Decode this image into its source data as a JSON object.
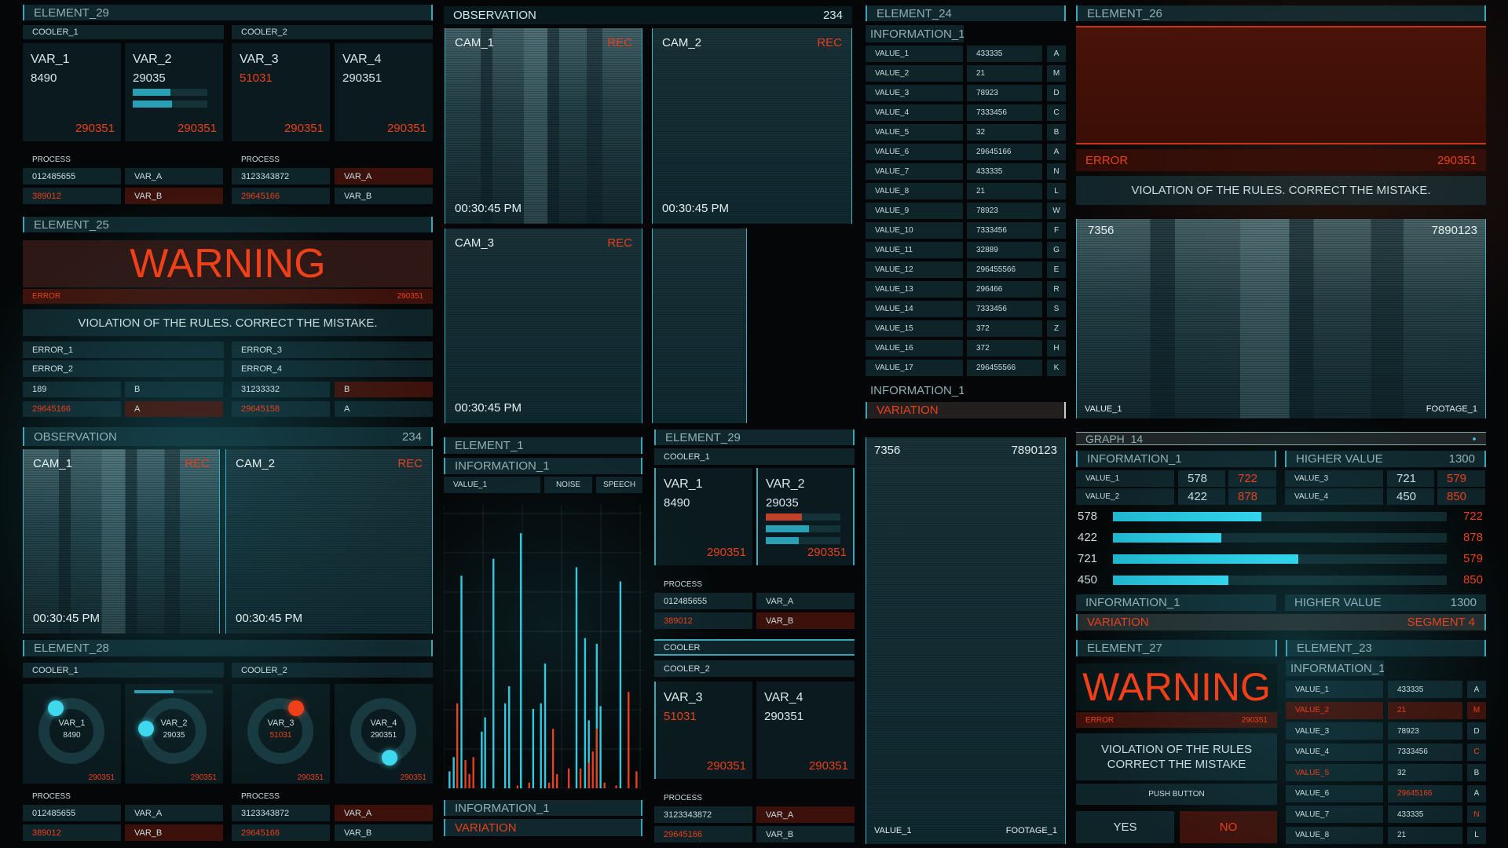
{
  "colors": {
    "accent": "#2fc9e0",
    "alert": "#e8401c",
    "text": "#c9dde0",
    "panel": "#1c4a54"
  },
  "top_left": {
    "title": "ELEMENT_29",
    "cooler_1": "COOLER_1",
    "cooler_2": "COOLER_2",
    "vars": [
      {
        "label": "VAR_1",
        "value": "8490",
        "footer": "290351"
      },
      {
        "label": "VAR_2",
        "value": "29035",
        "footer": "290351",
        "bars": [
          {
            "fill": 0.5,
            "color": "cyan"
          },
          {
            "fill": 0.53,
            "color": "cyan"
          }
        ]
      },
      {
        "label": "VAR_3",
        "value": "51031",
        "value_alert": true,
        "footer": "290351"
      },
      {
        "label": "VAR_4",
        "value": "290351",
        "footer": "290351"
      }
    ],
    "process": [
      {
        "label": "PROCESS",
        "rows": [
          {
            "a": "012485655",
            "b": "VAR_A"
          },
          {
            "a": "389012",
            "a_alert": true,
            "b": "VAR_B",
            "b_alert_bg": true
          }
        ]
      },
      {
        "label": "PROCESS",
        "rows": [
          {
            "a": "3123343872",
            "b": "VAR_A",
            "b_alert_bg": true
          },
          {
            "a": "29645166",
            "a_alert": true,
            "b": "VAR_B"
          }
        ]
      }
    ]
  },
  "element_25": {
    "title": "ELEMENT_25",
    "warning": "WARNING",
    "error_label": "ERROR",
    "error_code": "290351",
    "message": "VIOLATION OF THE RULES. CORRECT THE MISTAKE.",
    "errors": [
      "ERROR_1",
      "ERROR_3",
      "ERROR_2",
      "ERROR_4"
    ],
    "rows": [
      {
        "a": "189",
        "b": "B"
      },
      {
        "a": "31233332",
        "b": "B",
        "b_alert_bg": true
      },
      {
        "a": "29645166",
        "a_alert": true,
        "b": "A",
        "b_alert_bg": true
      },
      {
        "a": "29645158",
        "a_alert": true,
        "b": "A"
      }
    ]
  },
  "observation_left": {
    "title": "OBSERVATION",
    "count": "234",
    "cams": [
      {
        "name": "CAM_1",
        "rec": "REC",
        "time": "00:30:45 PM"
      },
      {
        "name": "CAM_2",
        "rec": "REC",
        "time": "00:30:45 PM"
      }
    ]
  },
  "element_28": {
    "title": "ELEMENT_28",
    "cooler_1": "COOLER_1",
    "cooler_2": "COOLER_2",
    "dials": [
      {
        "label": "VAR_1",
        "value": "8490",
        "footer": "290351",
        "angle_deg": -34,
        "dot": "cyan"
      },
      {
        "label": "VAR_2",
        "value": "29035",
        "footer": "290351",
        "angle_deg": -85,
        "dot": "cyan",
        "bar_fill": 0.5
      },
      {
        "label": "VAR_3",
        "value": "51031",
        "value_alert": true,
        "footer": "290351",
        "angle_deg": 34,
        "dot": "red"
      },
      {
        "label": "VAR_4",
        "value": "290351",
        "footer": "290351",
        "angle_deg": 167,
        "dot": "cyan"
      }
    ],
    "process": [
      {
        "label": "PROCESS",
        "rows": [
          {
            "a": "012485655",
            "b": "VAR_A"
          },
          {
            "a": "389012",
            "a_alert": true,
            "b": "VAR_B",
            "b_alert_bg": true
          }
        ]
      },
      {
        "label": "PROCESS",
        "rows": [
          {
            "a": "3123343872",
            "b": "VAR_A",
            "b_alert_bg": true
          },
          {
            "a": "29645166",
            "a_alert": true,
            "b": "VAR_B"
          }
        ]
      }
    ]
  },
  "observation_top": {
    "title": "OBSERVATION",
    "count": "234",
    "cams": [
      {
        "name": "CAM_1",
        "rec": "REC",
        "time": "00:30:45 PM"
      },
      {
        "name": "CAM_2",
        "rec": "REC",
        "time": "00:30:45 PM"
      },
      {
        "name": "CAM_3",
        "rec": "REC",
        "time": "00:30:45 PM"
      }
    ]
  },
  "element_1": {
    "title": "ELEMENT_1",
    "info": "INFORMATION_1",
    "tabs": [
      "VALUE_1",
      "NOISE",
      "SPEECH"
    ],
    "info_bottom": "INFORMATION_1",
    "variation": "VARIATION"
  },
  "chart_data": {
    "type": "bar",
    "title": "",
    "xlabel": "",
    "ylabel": "",
    "grid": true,
    "xlim": [
      0,
      100
    ],
    "ylim": [
      0,
      100
    ],
    "series": [
      {
        "color": "#2fc9e0",
        "x": [
          2.9,
          5,
          8.9,
          19.1,
          20.8,
          25,
          30.9,
          32.9,
          38.8,
          45,
          48.9,
          51,
          66.8,
          71.1,
          73,
          77,
          78.9,
          88.9
        ],
        "values": [
          6,
          11,
          75,
          20,
          25,
          81,
          30,
          36,
          90,
          28,
          30,
          44,
          78,
          53,
          24,
          51,
          29,
          73
        ]
      },
      {
        "color": "#e8401c",
        "x": [
          6.8,
          10.9,
          12.9,
          14.9,
          37.1,
          43,
          53,
          55,
          57,
          62.9,
          68.8,
          73,
          75,
          77,
          80.9,
          86.8,
          93,
          97
        ],
        "values": [
          30,
          10,
          5,
          11,
          1,
          2,
          2,
          21,
          5,
          7,
          7,
          9,
          13,
          21,
          2,
          1,
          34,
          6
        ]
      }
    ]
  },
  "element_29_mid": {
    "title": "ELEMENT_29",
    "cooler_1": "COOLER_1",
    "cooler": "COOLER",
    "cooler_2": "COOLER_2",
    "vars": [
      {
        "label": "VAR_1",
        "value": "8490",
        "footer": "290351"
      },
      {
        "label": "VAR_2",
        "value": "29035",
        "footer": "290351",
        "bars": [
          {
            "fill": 0.48,
            "color": "red"
          },
          {
            "fill": 0.58,
            "color": "cyan"
          },
          {
            "fill": 0.44,
            "color": "cyan"
          }
        ]
      }
    ],
    "process": {
      "label": "PROCESS",
      "rows": [
        {
          "a": "012485655",
          "b": "VAR_A"
        },
        {
          "a": "389012",
          "a_alert": true,
          "b": "VAR_B",
          "b_alert_bg": true
        }
      ]
    },
    "vars2": [
      {
        "label": "VAR_3",
        "value": "51031",
        "value_alert": true,
        "footer": "290351"
      },
      {
        "label": "VAR_4",
        "value": "290351",
        "footer": "290351"
      }
    ],
    "process2": {
      "label": "PROCESS",
      "rows": [
        {
          "a": "3123343872",
          "b": "VAR_A",
          "b_alert_bg": true
        },
        {
          "a": "29645166",
          "a_alert": true,
          "b": "VAR_B"
        }
      ]
    }
  },
  "element_24": {
    "title": "ELEMENT_24",
    "info": "INFORMATION_1",
    "rows": [
      {
        "label": "VALUE_1",
        "value": "433335",
        "code": "A"
      },
      {
        "label": "VALUE_2",
        "value": "21",
        "code": "M"
      },
      {
        "label": "VALUE_3",
        "value": "78923",
        "code": "D"
      },
      {
        "label": "VALUE_4",
        "value": "7333456",
        "code": "C"
      },
      {
        "label": "VALUE_5",
        "value": "32",
        "code": "B"
      },
      {
        "label": "VALUE_6",
        "value": "29645166",
        "code": "A"
      },
      {
        "label": "VALUE_7",
        "value": "433335",
        "code": "N"
      },
      {
        "label": "VALUE_8",
        "value": "21",
        "code": "L"
      },
      {
        "label": "VALUE_9",
        "value": "78923",
        "code": "W"
      },
      {
        "label": "VALUE_10",
        "value": "7333456",
        "code": "F"
      },
      {
        "label": "VALUE_11",
        "value": "32889",
        "code": "G"
      },
      {
        "label": "VALUE_12",
        "value": "296455566",
        "code": "E"
      },
      {
        "label": "VALUE_13",
        "value": "296466",
        "code": "R"
      },
      {
        "label": "VALUE_14",
        "value": "7333456",
        "code": "S"
      },
      {
        "label": "VALUE_15",
        "value": "372",
        "code": "Z"
      },
      {
        "label": "VALUE_16",
        "value": "372",
        "code": "H"
      },
      {
        "label": "VALUE_17",
        "value": "296455566",
        "code": "K"
      }
    ],
    "info_bottom": "INFORMATION_1",
    "variation": "VARIATION",
    "map": {
      "top_left": "7356",
      "top_right": "7890123",
      "bottom_left": "VALUE_1",
      "bottom_right": "FOOTAGE_1"
    }
  },
  "element_26": {
    "title": "ELEMENT_26",
    "error_label": "ERROR",
    "error_code": "290351",
    "message": "VIOLATION OF THE RULES. CORRECT THE MISTAKE.",
    "feed": {
      "top_left": "7356",
      "top_right": "7890123",
      "bottom_left": "VALUE_1",
      "bottom_right": "FOOTAGE_1"
    }
  },
  "graph_14": {
    "title": "GRAPH_14",
    "info": "INFORMATION_1",
    "higher_label": "HIGHER VALUE",
    "higher_value": "1300",
    "values": [
      {
        "label": "VALUE_1",
        "value": "578",
        "limit": "722"
      },
      {
        "label": "VALUE_3",
        "value": "721",
        "limit": "579"
      },
      {
        "label": "VALUE_2",
        "value": "422",
        "limit": "878"
      },
      {
        "label": "VALUE_4",
        "value": "450",
        "limit": "850"
      }
    ],
    "bars": [
      {
        "value": "578",
        "limit": "722"
      },
      {
        "value": "422",
        "limit": "878"
      },
      {
        "value": "721",
        "limit": "579"
      },
      {
        "value": "450",
        "limit": "850"
      }
    ],
    "bar_max": 1300,
    "info_bottom": "INFORMATION_1",
    "higher_label_bottom": "HIGHER VALUE",
    "higher_value_bottom": "1300",
    "variation": "VARIATION",
    "segment": "SEGMENT 4"
  },
  "element_27": {
    "title": "ELEMENT_27",
    "warning": "WARNING",
    "error_label": "ERROR",
    "error_code": "290351",
    "message_lines": [
      "VIOLATION OF THE RULES",
      "CORRECT THE MISTAKE"
    ],
    "push_button": "PUSH BUTTON",
    "yes": "YES",
    "no": "NO"
  },
  "element_23": {
    "title": "ELEMENT_23",
    "info": "INFORMATION_1",
    "rows": [
      {
        "label": "VALUE_1",
        "value": "433335",
        "code": "A"
      },
      {
        "label": "VALUE_2",
        "value": "21",
        "code": "M",
        "row_alert": true
      },
      {
        "label": "VALUE_3",
        "value": "78923",
        "code": "D"
      },
      {
        "label": "VALUE_4",
        "value": "7333456",
        "code": "C",
        "code_alert": true
      },
      {
        "label": "VALUE_5",
        "value": "32",
        "code": "B",
        "label_alert": true
      },
      {
        "label": "VALUE_6",
        "value": "29645166",
        "code": "A",
        "value_alert": true
      },
      {
        "label": "VALUE_7",
        "value": "433335",
        "code": "N",
        "code_alert": true
      },
      {
        "label": "VALUE_8",
        "value": "21",
        "code": "L"
      }
    ]
  }
}
